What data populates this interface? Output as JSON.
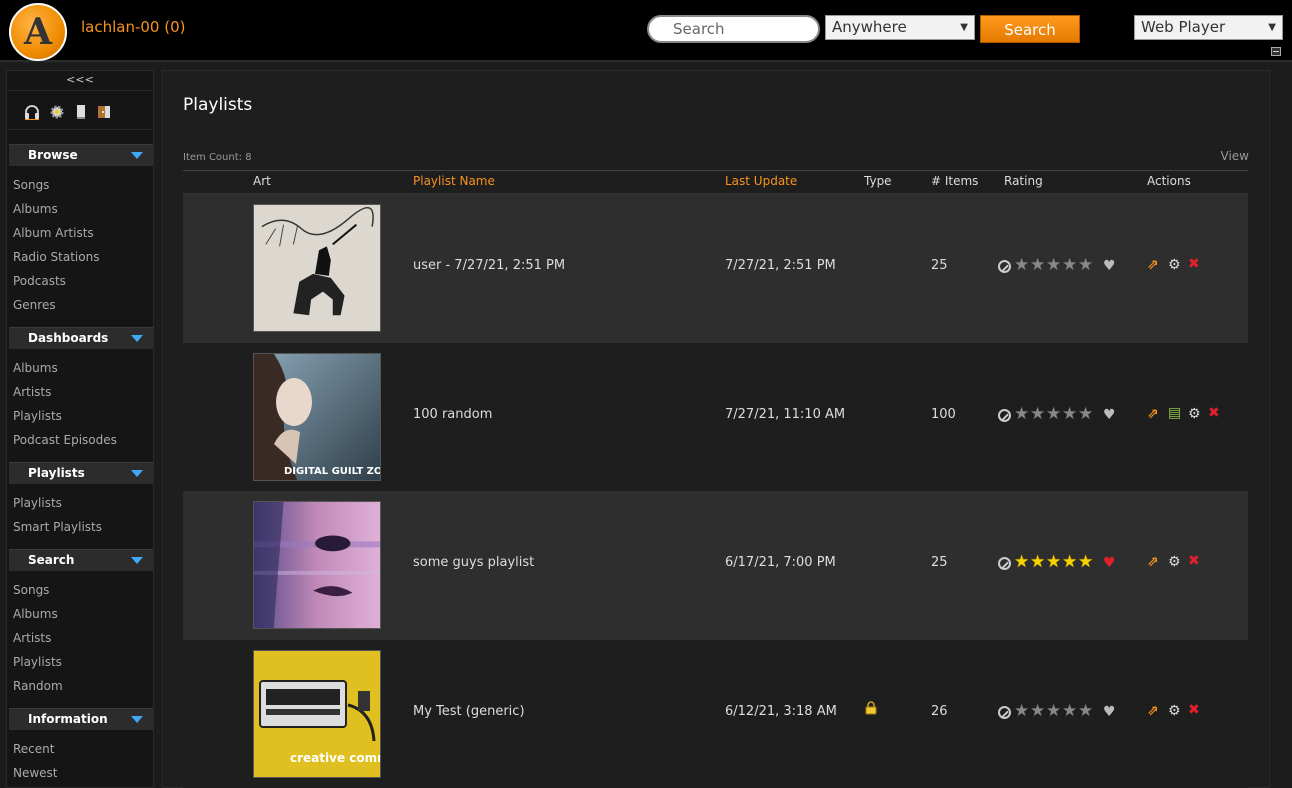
{
  "header": {
    "logo_letter": "A",
    "user": "lachlan-00 (0)",
    "search_placeholder": "Search",
    "scope": "Anywhere",
    "search_button": "Search",
    "player": "Web Player"
  },
  "sidebar": {
    "collapse": "<<<",
    "tabs": [
      "headphones-icon",
      "gear-icon",
      "document-icon",
      "logout-icon"
    ],
    "sections": [
      {
        "title": "Browse",
        "items": [
          "Songs",
          "Albums",
          "Album Artists",
          "Radio Stations",
          "Podcasts",
          "Genres"
        ]
      },
      {
        "title": "Dashboards",
        "items": [
          "Albums",
          "Artists",
          "Playlists",
          "Podcast Episodes"
        ]
      },
      {
        "title": "Playlists",
        "items": [
          "Playlists",
          "Smart Playlists"
        ]
      },
      {
        "title": "Search",
        "items": [
          "Songs",
          "Albums",
          "Artists",
          "Playlists",
          "Random"
        ]
      },
      {
        "title": "Information",
        "items": [
          "Recent",
          "Newest"
        ]
      }
    ]
  },
  "main": {
    "title": "Playlists",
    "item_count": "Item Count: 8",
    "view": "View",
    "columns": {
      "art": "Art",
      "name": "Playlist Name",
      "updated": "Last Update",
      "type": "Type",
      "items": "# Items",
      "rating": "Rating",
      "actions": "Actions"
    },
    "rows": [
      {
        "name": "user - 7/27/21, 2:51 PM",
        "updated": "7/27/21, 2:51 PM",
        "type_locked": false,
        "items": "25",
        "rating": 0,
        "favorite": false,
        "actions": [
          "edit",
          "settings",
          "delete"
        ],
        "art_caption": ""
      },
      {
        "name": "100 random",
        "updated": "7/27/21, 11:10 AM",
        "type_locked": false,
        "items": "100",
        "rating": 0,
        "favorite": false,
        "actions": [
          "edit",
          "document",
          "settings",
          "delete"
        ],
        "art_caption": "DIGITAL GUILT ZOE.LEELA"
      },
      {
        "name": "some guys playlist",
        "updated": "6/17/21, 7:00 PM",
        "type_locked": false,
        "items": "25",
        "rating": 5,
        "favorite": true,
        "actions": [
          "edit",
          "settings",
          "delete"
        ],
        "art_caption": ""
      },
      {
        "name": "My Test (generic)",
        "updated": "6/12/21, 3:18 AM",
        "type_locked": true,
        "items": "26",
        "rating": 0,
        "favorite": false,
        "actions": [
          "edit",
          "settings",
          "delete"
        ],
        "art_caption": "creative commons"
      }
    ]
  },
  "colors": {
    "accent": "#f7941d",
    "star_on": "#f5d400",
    "heart_on": "#e0202a",
    "toggle": "#3fa9f5"
  }
}
